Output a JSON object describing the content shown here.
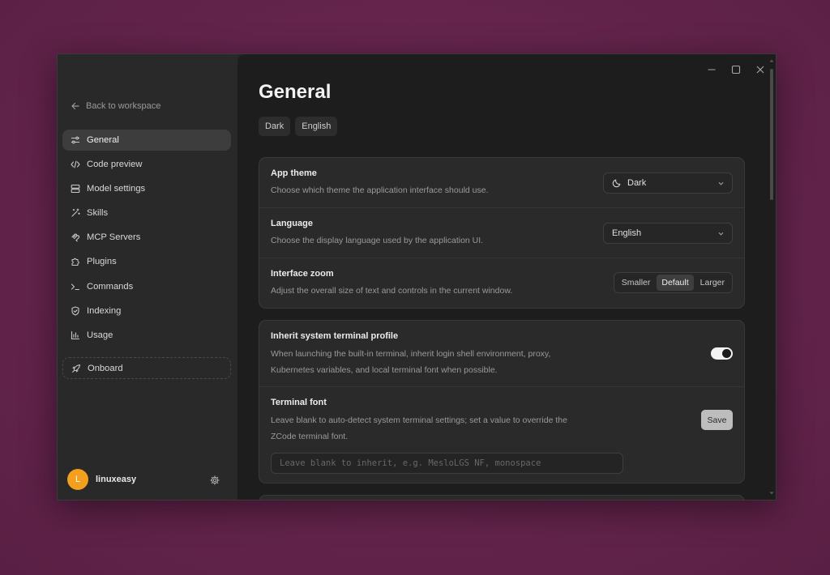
{
  "sidebar": {
    "back_label": "Back to workspace",
    "items": [
      {
        "label": "General",
        "icon": "sliders-icon",
        "active": true
      },
      {
        "label": "Code preview",
        "icon": "code-icon"
      },
      {
        "label": "Model settings",
        "icon": "server-icon"
      },
      {
        "label": "Skills",
        "icon": "magic-wand-icon"
      },
      {
        "label": "MCP Servers",
        "icon": "mcp-icon"
      },
      {
        "label": "Plugins",
        "icon": "puzzle-icon"
      },
      {
        "label": "Commands",
        "icon": "terminal-icon"
      },
      {
        "label": "Indexing",
        "icon": "shield-icon"
      },
      {
        "label": "Usage",
        "icon": "bar-chart-icon"
      }
    ],
    "onboard_label": "Onboard",
    "user": {
      "initial": "L",
      "name": "linuxeasy"
    }
  },
  "main": {
    "title": "General",
    "chips": [
      "Dark",
      "English"
    ],
    "appearance": {
      "app_theme": {
        "title": "App theme",
        "desc": "Choose which theme the application interface should use.",
        "value": "Dark"
      },
      "language": {
        "title": "Language",
        "desc": "Choose the display language used by the application UI.",
        "value": "English"
      },
      "zoom": {
        "title": "Interface zoom",
        "desc": "Adjust the overall size of text and controls in the current window.",
        "options": [
          "Smaller",
          "Default",
          "Larger"
        ],
        "selected": "Default"
      }
    },
    "terminal": {
      "inherit": {
        "title": "Inherit system terminal profile",
        "desc": "When launching the built-in terminal, inherit login shell environment, proxy, Kubernetes variables, and local terminal font when possible.",
        "enabled": true
      },
      "font": {
        "title": "Terminal font",
        "desc": "Leave blank to auto-detect system terminal settings; set a value to override the ZCode terminal font.",
        "placeholder": "Leave blank to inherit, e.g. MesloLGS NF, monospace",
        "save_label": "Save"
      }
    }
  },
  "colors": {
    "background": "#64244c",
    "accent_avatar": "#f2a01e",
    "toggle_on": "#f2f2f2"
  }
}
